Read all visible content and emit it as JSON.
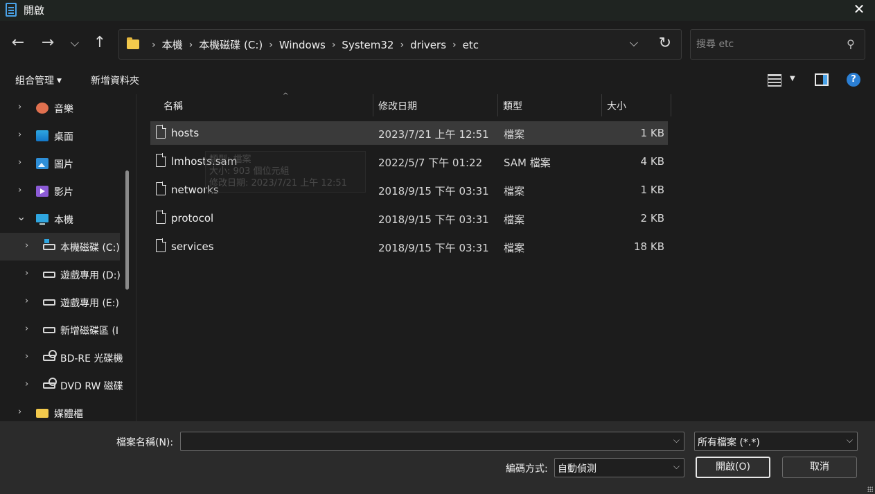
{
  "window": {
    "title": "開啟",
    "close_glyph": "✕"
  },
  "nav": {
    "back_glyph": "←",
    "forward_glyph": "→",
    "recent_glyph": "⌵",
    "up_glyph": "↑",
    "breadcrumbs": [
      "本機",
      "本機磁碟 (C:)",
      "Windows",
      "System32",
      "drivers",
      "etc"
    ],
    "dropdown_glyph": "⌵",
    "refresh_glyph": "↻",
    "search_placeholder": "搜尋 etc"
  },
  "toolbar": {
    "organize_label": "組合管理",
    "new_folder_label": "新增資料夾",
    "help_label": "?"
  },
  "sidebar": {
    "items": [
      {
        "label": "音樂",
        "icon": "music-icon",
        "chevron": "›",
        "depth": 0,
        "selected": false
      },
      {
        "label": "桌面",
        "icon": "desktop-icon",
        "chevron": "›",
        "depth": 0,
        "selected": false
      },
      {
        "label": "圖片",
        "icon": "pictures-icon",
        "chevron": "›",
        "depth": 0,
        "selected": false
      },
      {
        "label": "影片",
        "icon": "videos-icon",
        "chevron": "›",
        "depth": 0,
        "selected": false
      },
      {
        "label": "本機",
        "icon": "this-pc-icon",
        "chevron": "⌄",
        "depth": 0,
        "selected": false
      },
      {
        "label": "本機磁碟 (C:)",
        "icon": "windows-drive-icon",
        "chevron": "›",
        "depth": 1,
        "selected": true
      },
      {
        "label": "遊戲專用 (D:)",
        "icon": "drive-icon",
        "chevron": "›",
        "depth": 1,
        "selected": false
      },
      {
        "label": "遊戲專用 (E:)",
        "icon": "drive-icon",
        "chevron": "›",
        "depth": 1,
        "selected": false
      },
      {
        "label": "新增磁碟區 (I",
        "icon": "drive-icon",
        "chevron": "›",
        "depth": 1,
        "selected": false
      },
      {
        "label": "BD-RE 光碟機",
        "icon": "optical-drive-icon",
        "chevron": "›",
        "depth": 1,
        "selected": false
      },
      {
        "label": "DVD RW 磁碟",
        "icon": "optical-drive-icon",
        "chevron": "›",
        "depth": 1,
        "selected": false
      },
      {
        "label": "媒體櫃",
        "icon": "folder-icon",
        "chevron": "›",
        "depth": 0,
        "selected": false
      }
    ]
  },
  "filelist": {
    "columns": {
      "name": "名稱",
      "modified": "修改日期",
      "type": "類型",
      "size": "大小"
    },
    "sort_glyph": "^",
    "rows": [
      {
        "name": "hosts",
        "modified": "2023/7/21 上午 12:51",
        "type": "檔案",
        "size": "1 KB",
        "hover": true
      },
      {
        "name": "lmhosts.sam",
        "modified": "2022/5/7 下午 01:22",
        "type": "SAM 檔案",
        "size": "4 KB",
        "hover": false
      },
      {
        "name": "networks",
        "modified": "2018/9/15 下午 03:31",
        "type": "檔案",
        "size": "1 KB",
        "hover": false
      },
      {
        "name": "protocol",
        "modified": "2018/9/15 下午 03:31",
        "type": "檔案",
        "size": "2 KB",
        "hover": false
      },
      {
        "name": "services",
        "modified": "2018/9/15 下午 03:31",
        "type": "檔案",
        "size": "18 KB",
        "hover": false
      }
    ],
    "tooltip": {
      "line1": "類型: 檔案",
      "line2": "大小: 903 個位元組",
      "line3": "修改日期: 2023/7/21 上午 12:51"
    }
  },
  "bottom": {
    "filename_label": "檔案名稱(N):",
    "filename_value": "",
    "filetype_value": "所有檔案  (*.*)",
    "encoding_label": "編碼方式:",
    "encoding_value": "自動偵測",
    "open_button": "開啟(O)",
    "cancel_button": "取消"
  }
}
